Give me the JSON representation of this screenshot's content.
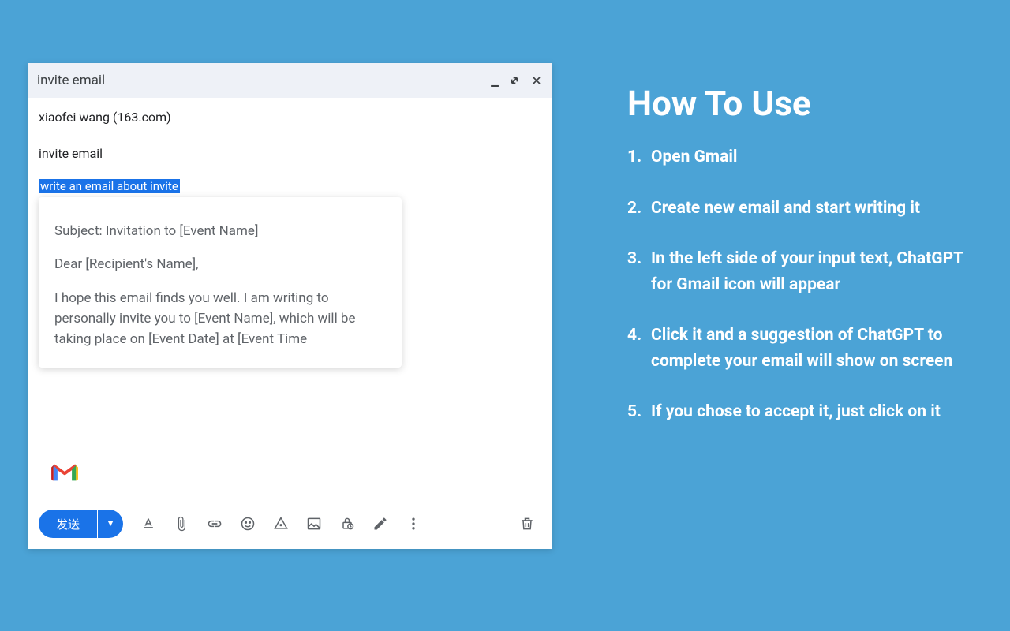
{
  "compose": {
    "title": "invite email",
    "to": "xiaofei wang (163.com)",
    "subject": "invite email",
    "selected_text": "write an email about invite",
    "send_label": "发送"
  },
  "suggestion": {
    "line1": "Subject: Invitation to [Event Name]",
    "line2": "Dear [Recipient's Name],",
    "line3": "I hope this email finds you well. I am writing to personally invite you to [Event Name], which will be taking place on [Event Date] at [Event Time"
  },
  "howto": {
    "title": "How To Use",
    "steps": [
      "Open Gmail",
      "Create new email and start writing it",
      "In the left side of your input text, ChatGPT for Gmail icon will appear",
      "Click it and a suggestion of ChatGPT to complete your email will show on screen",
      "If you chose to accept it, just click on it"
    ]
  }
}
